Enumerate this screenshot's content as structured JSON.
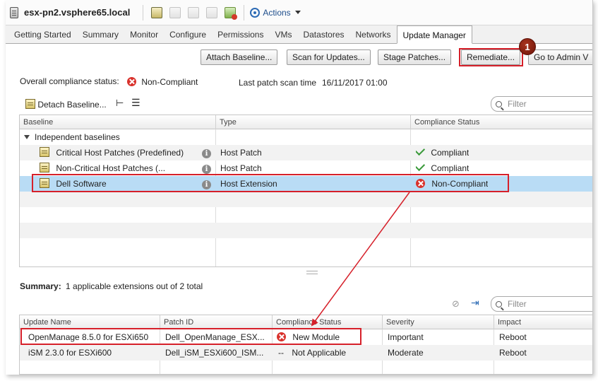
{
  "header": {
    "host_title": "esx-pn2.vsphere65.local",
    "actions_label": "Actions"
  },
  "tabs": [
    {
      "label": "Getting Started"
    },
    {
      "label": "Summary"
    },
    {
      "label": "Monitor"
    },
    {
      "label": "Configure"
    },
    {
      "label": "Permissions"
    },
    {
      "label": "VMs"
    },
    {
      "label": "Datastores"
    },
    {
      "label": "Networks"
    },
    {
      "label": "Update Manager",
      "selected": true
    }
  ],
  "commands": {
    "attach": "Attach Baseline...",
    "scan": "Scan for Updates...",
    "stage": "Stage Patches...",
    "remediate": "Remediate...",
    "admin": "Go to Admin V"
  },
  "callout_number": "1",
  "compliance": {
    "overall_label": "Overall compliance status:",
    "overall_value": "Non-Compliant",
    "last_scan_label": "Last patch scan time",
    "last_scan_value": "16/11/2017 01:00"
  },
  "baseline_toolbar": {
    "detach_label": "Detach Baseline..."
  },
  "filter_placeholder": "Filter",
  "baselines_table": {
    "headers": [
      "Baseline",
      "Type",
      "Compliance Status"
    ],
    "group": "Independent baselines",
    "rows": [
      {
        "name": "Critical Host Patches (Predefined)",
        "type": "Host Patch",
        "status": "Compliant"
      },
      {
        "name": "Non-Critical Host Patches (...",
        "type": "Host Patch",
        "status": "Compliant"
      },
      {
        "name": "Dell Software",
        "type": "Host Extension",
        "status": "Non-Compliant",
        "selected": true
      }
    ]
  },
  "summary": {
    "label": "Summary:",
    "text": "1 applicable extensions out of 2 total"
  },
  "updates_table": {
    "headers": [
      "Update Name",
      "Patch ID",
      "Compliance Status",
      "Severity",
      "Impact"
    ],
    "rows": [
      {
        "name": "OpenManage 8.5.0 for ESXi650",
        "patch_id": "Dell_OpenManage_ESX...",
        "status": "New Module",
        "severity": "Important",
        "impact": "Reboot"
      },
      {
        "name": "iSM 2.3.0 for ESXi600",
        "patch_id": "Dell_iSM_ESXi600_ISM...",
        "status_prefix": "--",
        "status": "Not Applicable",
        "severity": "Moderate",
        "impact": "Reboot"
      }
    ]
  },
  "colors": {
    "highlight": "#d6202a",
    "selection": "#b9dcf5",
    "error": "#d9322c",
    "ok": "#3a9a3a"
  }
}
